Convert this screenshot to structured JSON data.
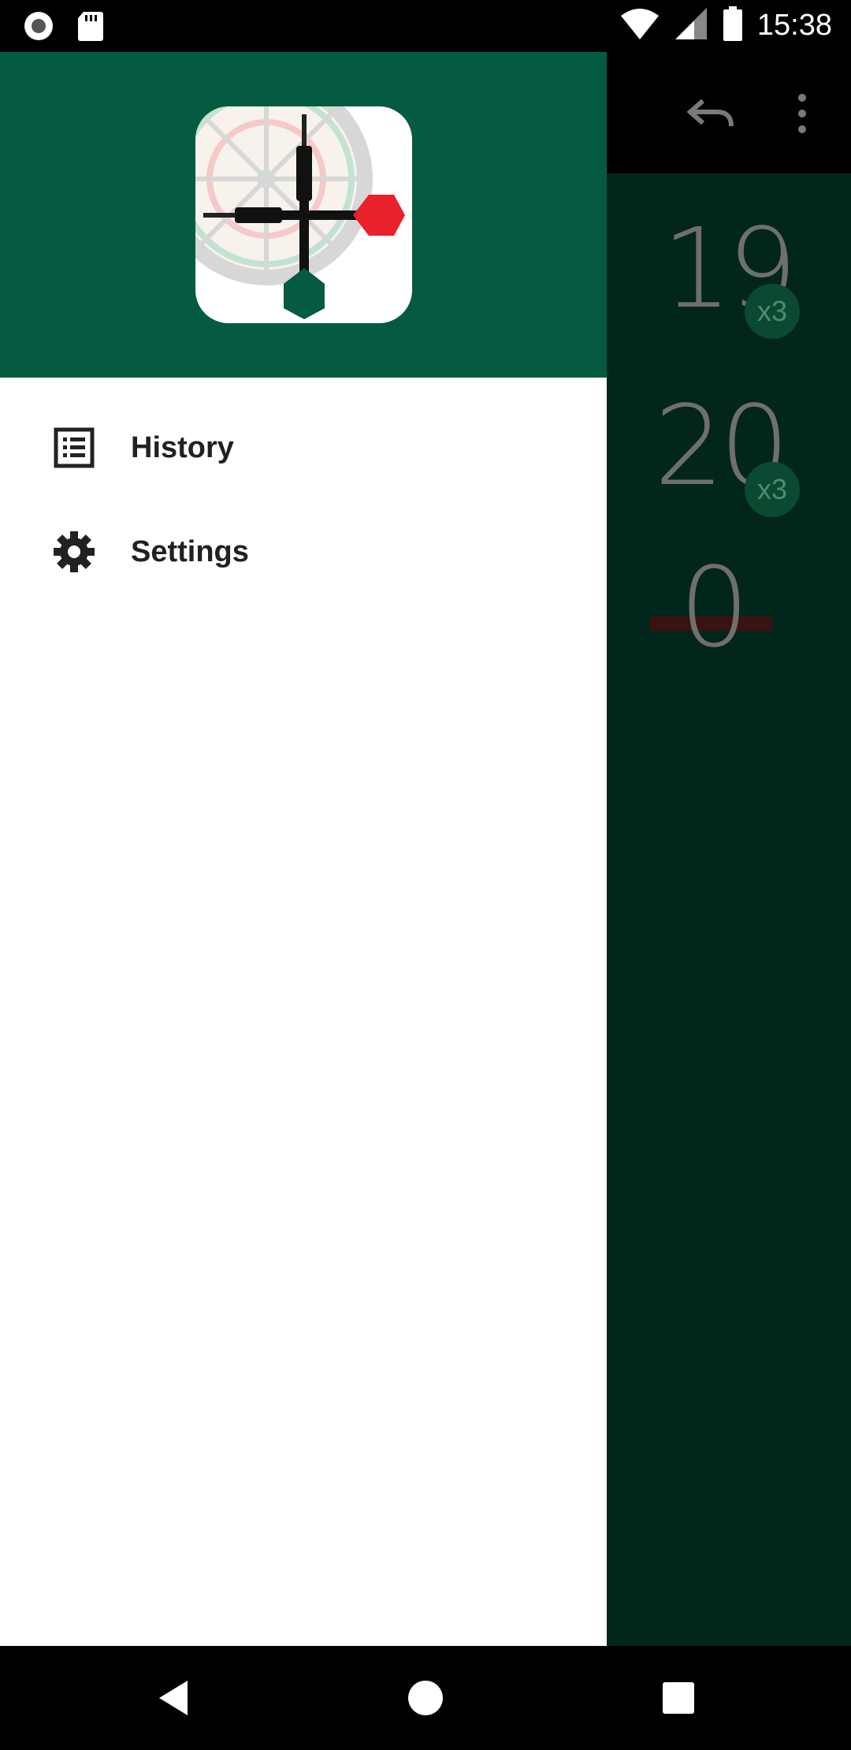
{
  "status_bar": {
    "time": "15:38",
    "icons": [
      "record-icon",
      "sd-card-icon",
      "wifi-icon",
      "signal-icon",
      "battery-icon"
    ]
  },
  "app": {
    "toolbar_icons": [
      "undo-icon",
      "more-vert-icon"
    ],
    "scores": [
      {
        "value": "19",
        "badge": "x3"
      },
      {
        "value": "20",
        "badge": "x3"
      },
      {
        "value": "0",
        "badge": ""
      }
    ],
    "colors": {
      "primary_dark": "#02261C",
      "primary": "#045B41",
      "accent_red": "#E8212A"
    }
  },
  "drawer": {
    "header_logo": "dartboard-logo",
    "items": [
      {
        "label": "History",
        "icon": "list-icon"
      },
      {
        "label": "Settings",
        "icon": "gear-icon"
      }
    ]
  },
  "nav_bar": {
    "buttons": [
      "back-icon",
      "home-icon",
      "recents-icon"
    ]
  }
}
